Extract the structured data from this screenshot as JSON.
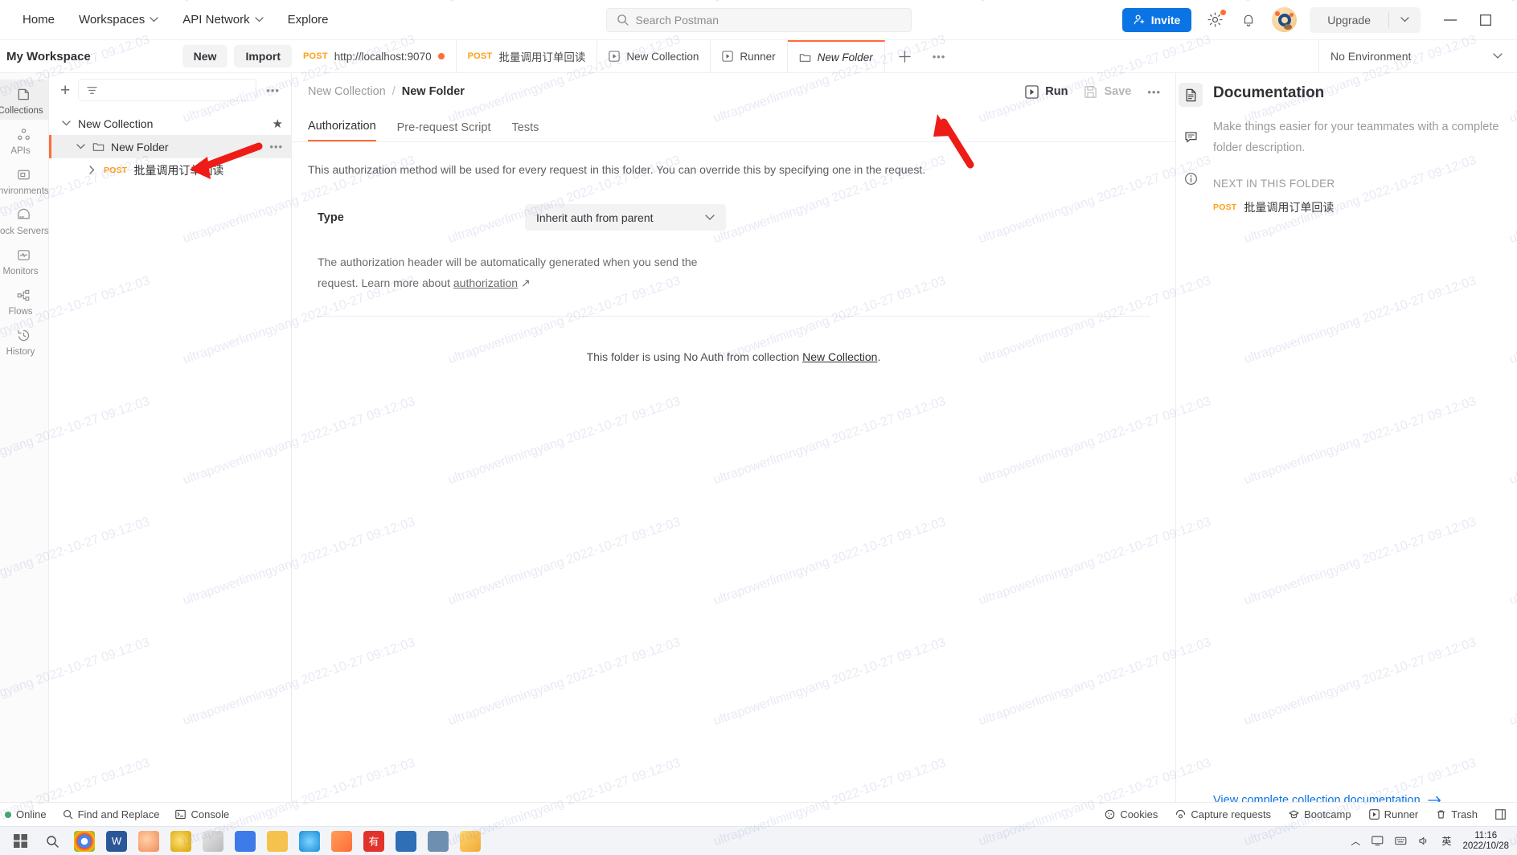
{
  "topbar": {
    "menu": [
      {
        "label": "Home",
        "caret": false,
        "name": "menu-home"
      },
      {
        "label": "Workspaces",
        "caret": true,
        "name": "menu-workspaces"
      },
      {
        "label": "API Network",
        "caret": true,
        "name": "menu-api-network"
      },
      {
        "label": "Explore",
        "caret": false,
        "name": "menu-explore"
      }
    ],
    "search_placeholder": "Search Postman",
    "invite_label": "Invite",
    "upgrade_label": "Upgrade",
    "icons": {
      "search": "search-icon",
      "settings": "gear-icon",
      "notifications": "bell-icon",
      "avatar": "user-avatar",
      "minimize": "minimize-icon",
      "maximize": "maximize-icon"
    }
  },
  "workspace": {
    "title": "My Workspace",
    "new_label": "New",
    "import_label": "Import"
  },
  "tabs": [
    {
      "method": "POST",
      "label": "http://localhost:9070",
      "unsaved": true,
      "active": false,
      "icon": "",
      "name": "tab-localhost-9070"
    },
    {
      "method": "POST",
      "label": "批量调用订单回读",
      "unsaved": false,
      "active": false,
      "icon": "",
      "name": "tab-batch-order-readback"
    },
    {
      "method": "",
      "label": "New Collection",
      "unsaved": false,
      "active": false,
      "icon": "collection-run-icon",
      "name": "tab-new-collection"
    },
    {
      "method": "",
      "label": "Runner",
      "unsaved": false,
      "active": false,
      "icon": "runner-icon",
      "name": "tab-runner"
    },
    {
      "method": "",
      "label": "New Folder",
      "unsaved": false,
      "active": true,
      "icon": "folder-icon",
      "name": "tab-new-folder"
    }
  ],
  "environment": {
    "selected": "No Environment"
  },
  "rail": [
    {
      "label": "Collections",
      "icon": "collections-icon",
      "active": true,
      "name": "rail-collections"
    },
    {
      "label": "APIs",
      "icon": "apis-icon",
      "active": false,
      "name": "rail-apis"
    },
    {
      "label": "Environments",
      "icon": "environments-icon",
      "active": false,
      "name": "rail-environments"
    },
    {
      "label": "Mock Servers",
      "icon": "mock-servers-icon",
      "active": false,
      "name": "rail-mock-servers"
    },
    {
      "label": "Monitors",
      "icon": "monitors-icon",
      "active": false,
      "name": "rail-monitors"
    },
    {
      "label": "Flows",
      "icon": "flows-icon",
      "active": false,
      "name": "rail-flows"
    },
    {
      "label": "History",
      "icon": "history-icon",
      "active": false,
      "name": "rail-history"
    }
  ],
  "sidebar": {
    "filter_placeholder": "",
    "tree": [
      {
        "label": "New Collection",
        "type": "collection",
        "depth": 0,
        "expanded": true,
        "selected": false,
        "starred": true,
        "method": "",
        "name": "tree-new-collection"
      },
      {
        "label": "New Folder",
        "type": "folder",
        "depth": 1,
        "expanded": true,
        "selected": true,
        "starred": false,
        "method": "",
        "name": "tree-new-folder"
      },
      {
        "label": "批量调用订单回读",
        "type": "request",
        "depth": 2,
        "expanded": false,
        "selected": false,
        "starred": false,
        "method": "POST",
        "name": "tree-request-batch-order-readback"
      }
    ]
  },
  "main": {
    "breadcrumb": {
      "parent": "New Collection",
      "separator": "/",
      "current": "New Folder"
    },
    "actions": {
      "run": "Run",
      "save": "Save"
    },
    "tabs": [
      {
        "label": "Authorization",
        "active": true,
        "name": "content-tab-authorization"
      },
      {
        "label": "Pre-request Script",
        "active": false,
        "name": "content-tab-pre-request-script"
      },
      {
        "label": "Tests",
        "active": false,
        "name": "content-tab-tests"
      }
    ],
    "auth_hint": "This authorization method will be used for every request in this folder. You can override this by specifying one in the request.",
    "type_label": "Type",
    "type_value": "Inherit auth from parent",
    "note_text": "The authorization header will be automatically generated when you send the request. Learn more about ",
    "note_link": "authorization",
    "noauth_prefix": "This folder is using No Auth from collection ",
    "noauth_link": "New Collection",
    "noauth_suffix": "."
  },
  "docs": {
    "title": "Documentation",
    "subtitle": "Make things easier for your teammates with a complete folder description.",
    "next_label": "NEXT IN THIS FOLDER",
    "next_item": {
      "method": "POST",
      "label": "批量调用订单回读"
    },
    "link": "View complete collection documentation"
  },
  "status": {
    "online": "Online",
    "find_replace": "Find and Replace",
    "console": "Console",
    "cookies": "Cookies",
    "capture": "Capture requests",
    "bootcamp": "Bootcamp",
    "runner": "Runner",
    "trash": "Trash"
  },
  "taskbar": {
    "time": "11:16",
    "date": "2022/10/28",
    "ime": "英"
  },
  "watermark": {
    "text": "ultrapowerlimingyang 2022-10-27 09:12:03"
  },
  "colors": {
    "accent": "#ff6c37",
    "link": "#0b74e5",
    "method": "#ff9f1a",
    "online": "#3fa86b"
  }
}
